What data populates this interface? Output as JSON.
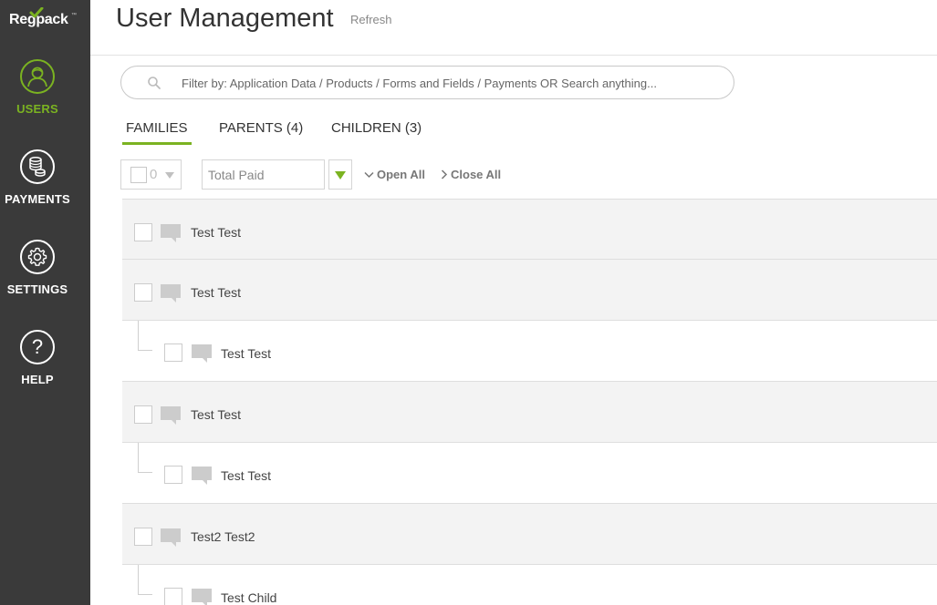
{
  "brand": {
    "logo_text": "Regpack",
    "logo_tm": "™",
    "accent": "#7bb321",
    "sidebar_bg": "#3a3a3a"
  },
  "sidebar": {
    "items": [
      {
        "label": "USERS",
        "icon": "user-icon",
        "active": true
      },
      {
        "label": "PAYMENTS",
        "icon": "coins-icon",
        "active": false
      },
      {
        "label": "SETTINGS",
        "icon": "gear-icon",
        "active": false
      },
      {
        "label": "HELP",
        "icon": "question-icon",
        "active": false
      }
    ]
  },
  "header": {
    "title": "User Management",
    "refresh_label": "Refresh"
  },
  "search": {
    "placeholder": "Filter by: Application Data / Products / Forms and Fields / Payments OR Search anything..."
  },
  "tabs": [
    {
      "label": "FAMILIES",
      "active": true
    },
    {
      "label": "PARENTS (4)",
      "active": false
    },
    {
      "label": "CHILDREN (3)",
      "active": false
    }
  ],
  "toolbar": {
    "selected_count": "0",
    "sort_value": "Total Paid",
    "open_all_label": "Open All",
    "close_all_label": "Close All"
  },
  "rows": [
    {
      "type": "parent",
      "name": "Test Test"
    },
    {
      "type": "parent",
      "name": "Test Test"
    },
    {
      "type": "child",
      "name": "Test Test"
    },
    {
      "type": "parent",
      "name": "Test Test"
    },
    {
      "type": "child",
      "name": "Test Test"
    },
    {
      "type": "parent",
      "name": "Test2 Test2"
    },
    {
      "type": "child",
      "name": "Test Child"
    }
  ]
}
